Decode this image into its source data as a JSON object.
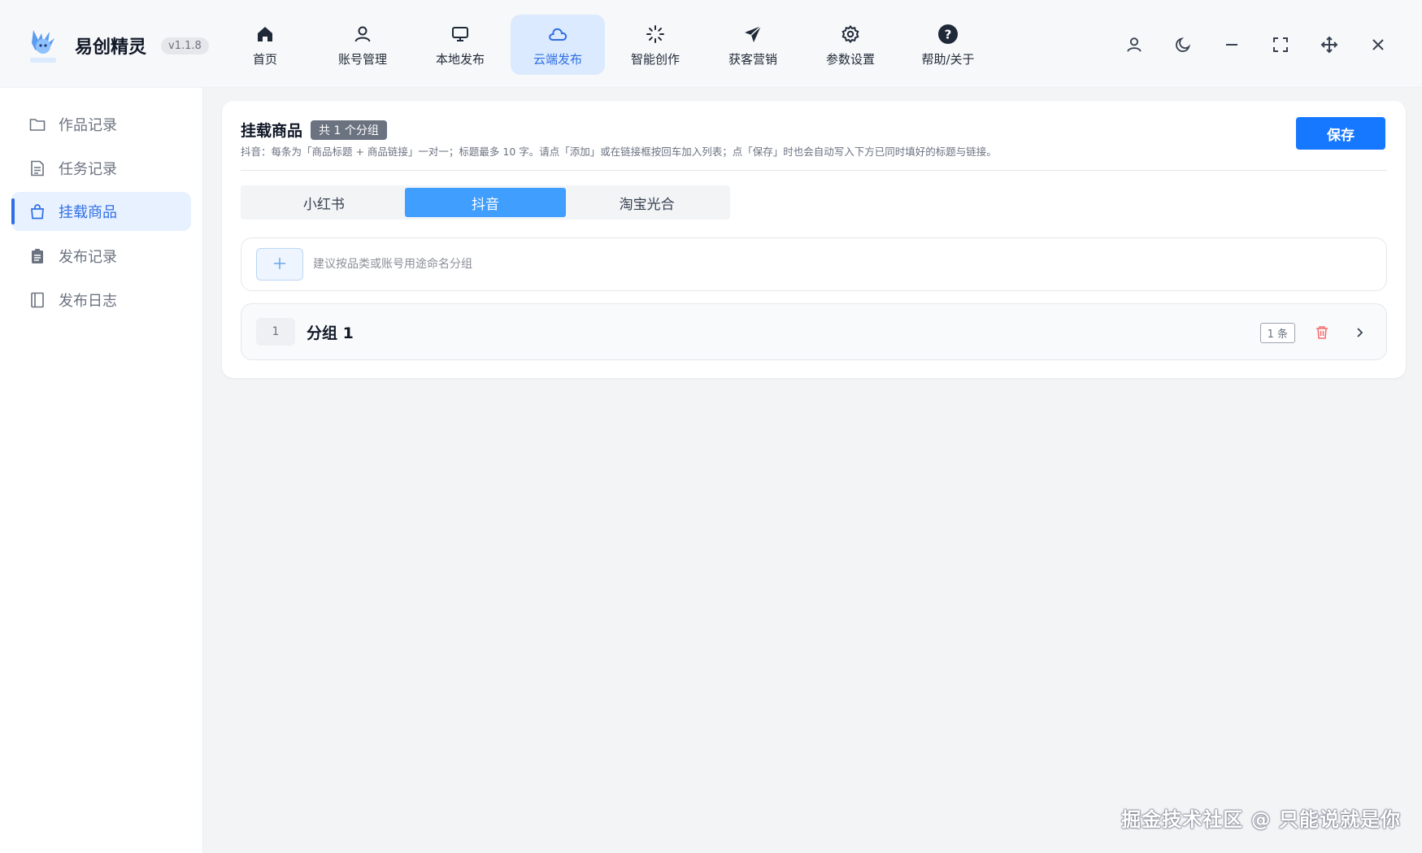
{
  "app": {
    "title": "易创精灵",
    "version": "v1.1.8",
    "logo_caption": "易创精灵"
  },
  "nav": {
    "items": [
      {
        "label": "首页",
        "icon": "home-icon",
        "active": false
      },
      {
        "label": "账号管理",
        "icon": "user-icon",
        "active": false
      },
      {
        "label": "本地发布",
        "icon": "monitor-icon",
        "active": false
      },
      {
        "label": "云端发布",
        "icon": "cloud-icon",
        "active": true
      },
      {
        "label": "智能创作",
        "icon": "sparkle-icon",
        "active": false
      },
      {
        "label": "获客营销",
        "icon": "send-icon",
        "active": false
      },
      {
        "label": "参数设置",
        "icon": "gear-icon",
        "active": false
      },
      {
        "label": "帮助/关于",
        "icon": "help-icon",
        "active": false
      }
    ]
  },
  "window_controls": [
    "user-icon",
    "moon-icon",
    "minimize-icon",
    "fullscreen-icon",
    "move-icon",
    "close-icon"
  ],
  "sidebar": {
    "items": [
      {
        "label": "作品记录",
        "icon": "folder-icon",
        "active": false
      },
      {
        "label": "任务记录",
        "icon": "document-icon",
        "active": false
      },
      {
        "label": "挂载商品",
        "icon": "shopping-bag-icon",
        "active": true
      },
      {
        "label": "发布记录",
        "icon": "clipboard-icon",
        "active": false
      },
      {
        "label": "发布日志",
        "icon": "notebook-icon",
        "active": false
      }
    ]
  },
  "main": {
    "title": "挂载商品",
    "group_count_badge": "共 1 个分组",
    "description": "抖音：每条为「商品标题 + 商品链接」一对一；标题最多 10 字。请点「添加」或在链接框按回车加入列表；点「保存」时也会自动写入下方已同时填好的标题与链接。",
    "save_label": "保存",
    "tabs": [
      {
        "label": "小红书",
        "active": false
      },
      {
        "label": "抖音",
        "active": true
      },
      {
        "label": "淘宝光合",
        "active": false
      }
    ],
    "add_group": {
      "placeholder": "建议按品类或账号用途命名分组",
      "value": ""
    },
    "groups": [
      {
        "index": "1",
        "name": "分组 1",
        "count": "1 条"
      }
    ]
  },
  "watermark": "掘金技术社区 @ 只能说就是你",
  "colors": {
    "accent": "#1677ff",
    "tab_active": "#409eff",
    "nav_active_bg": "#dbeafe",
    "danger": "#f56c6c"
  }
}
